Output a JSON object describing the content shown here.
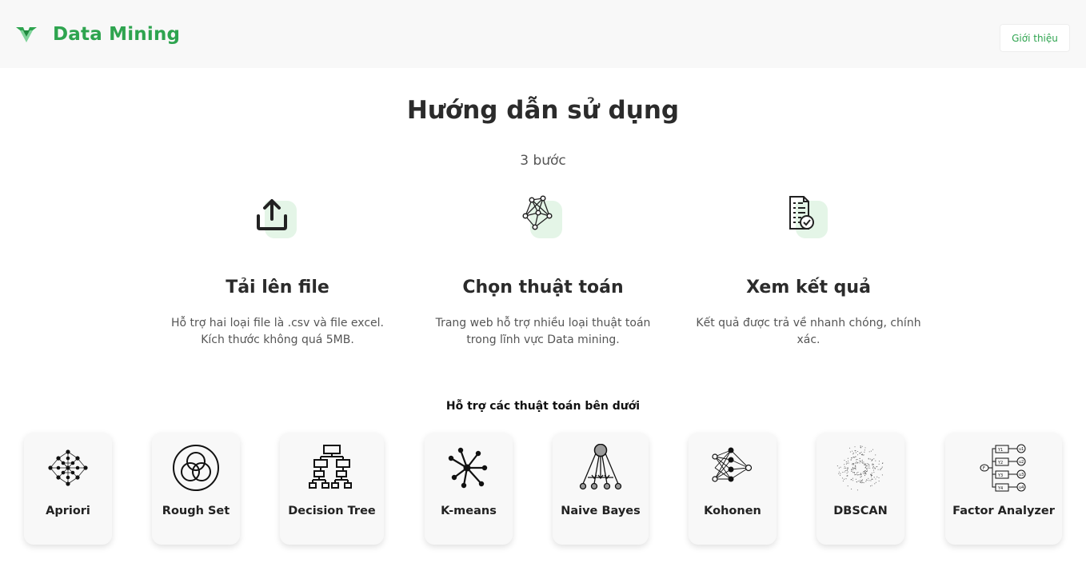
{
  "header": {
    "brand": "Data Mining",
    "about_label": "Giới thiệu",
    "logo_icon": "green-v-logo-icon",
    "brand_color": "#2ea44f"
  },
  "guide": {
    "title": "Hướng dẫn sử dụng",
    "subtitle": "3 bước",
    "steps": [
      {
        "icon": "upload-icon",
        "title": "Tải lên file",
        "description": "Hỗ trợ hai loại file là .csv và file excel. Kích thước không quá 5MB."
      },
      {
        "icon": "network-graph-icon",
        "title": "Chọn thuật toán",
        "description": "Trang web hỗ trợ nhiều loại thuật toán trong lĩnh vực Data mining."
      },
      {
        "icon": "report-check-icon",
        "title": "Xem kết quả",
        "description": "Kết quả được trả về nhanh chóng, chính xác."
      }
    ]
  },
  "algorithms": {
    "heading": "Hỗ trợ các thuật toán bên dưới",
    "items": [
      {
        "label": "Apriori",
        "icon": "neural-lattice-icon"
      },
      {
        "label": "Rough Set",
        "icon": "venn-circles-icon"
      },
      {
        "label": "Decision Tree",
        "icon": "tree-hierarchy-icon"
      },
      {
        "label": "K-means",
        "icon": "cluster-star-icon"
      },
      {
        "label": "Naive Bayes",
        "icon": "bayes-pendulum-icon"
      },
      {
        "label": "Kohonen",
        "icon": "neural-network-icon"
      },
      {
        "label": "DBSCAN",
        "icon": "density-scatter-icon"
      },
      {
        "label": "Factor Analyzer",
        "icon": "factor-diagram-icon"
      }
    ]
  }
}
